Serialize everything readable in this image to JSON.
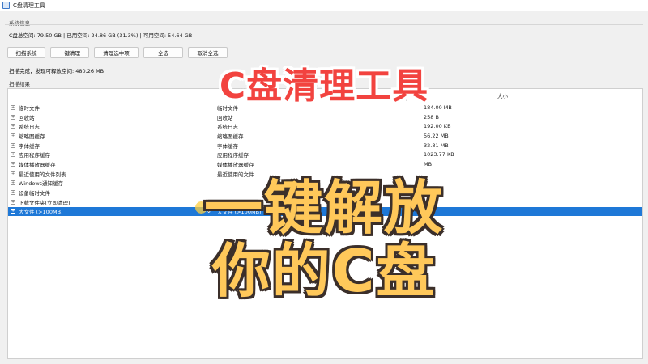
{
  "window": {
    "title": "C盘清理工具"
  },
  "system_info": {
    "section_label": "系统信息",
    "disk_summary": "C盘总空间: 79.50 GB | 已用空间: 24.86 GB (31.3%) | 可用空间: 54.64 GB"
  },
  "toolbar": {
    "scan_label": "扫描系统",
    "one_click_label": "一键清理",
    "clean_selected_label": "清理选中项",
    "select_all_label": "全选",
    "deselect_all_label": "取消全选"
  },
  "status": {
    "text": "扫描完成，发现可释放空间: 480.26 MB"
  },
  "results": {
    "section_label": "扫描结果",
    "columns": {
      "size": "大小"
    },
    "rows": [
      {
        "name": "临时文件",
        "type": "临时文件",
        "size": "184.00 MB"
      },
      {
        "name": "回收站",
        "type": "回收站",
        "size": "258 B"
      },
      {
        "name": "系统日志",
        "type": "系统日志",
        "size": "192.00 KB"
      },
      {
        "name": "缩略图缓存",
        "type": "缩略图缓存",
        "size": "56.22 MB"
      },
      {
        "name": "字体缓存",
        "type": "字体缓存",
        "size": "32.81 MB"
      },
      {
        "name": "应用程序缓存",
        "type": "应用程序缓存",
        "size": "1023.77 KB"
      },
      {
        "name": "媒体播放器缓存",
        "type": "媒体播放器缓存",
        "size": "MB"
      },
      {
        "name": "最近使用的文件列表",
        "type": "最近使用的文件",
        "size": ""
      },
      {
        "name": "Windows通知缓存",
        "type": "",
        "size": ""
      },
      {
        "name": "设备临时文件",
        "type": "",
        "size": ""
      },
      {
        "name": "下载文件夹(立即清理)",
        "type": "下载文件夹(立即清",
        "size": ""
      },
      {
        "name": "大文件 (>100MB)",
        "type": "大文件 (>100MB)",
        "size": "",
        "selected": true
      }
    ]
  },
  "overlay": {
    "line1": "C盘清理工具",
    "line2": "一键解放",
    "line3": "你的C盘"
  },
  "colors": {
    "selection": "#1e78d7",
    "headline_red": "#f2433f",
    "headline_gold": "#ffc85a"
  }
}
